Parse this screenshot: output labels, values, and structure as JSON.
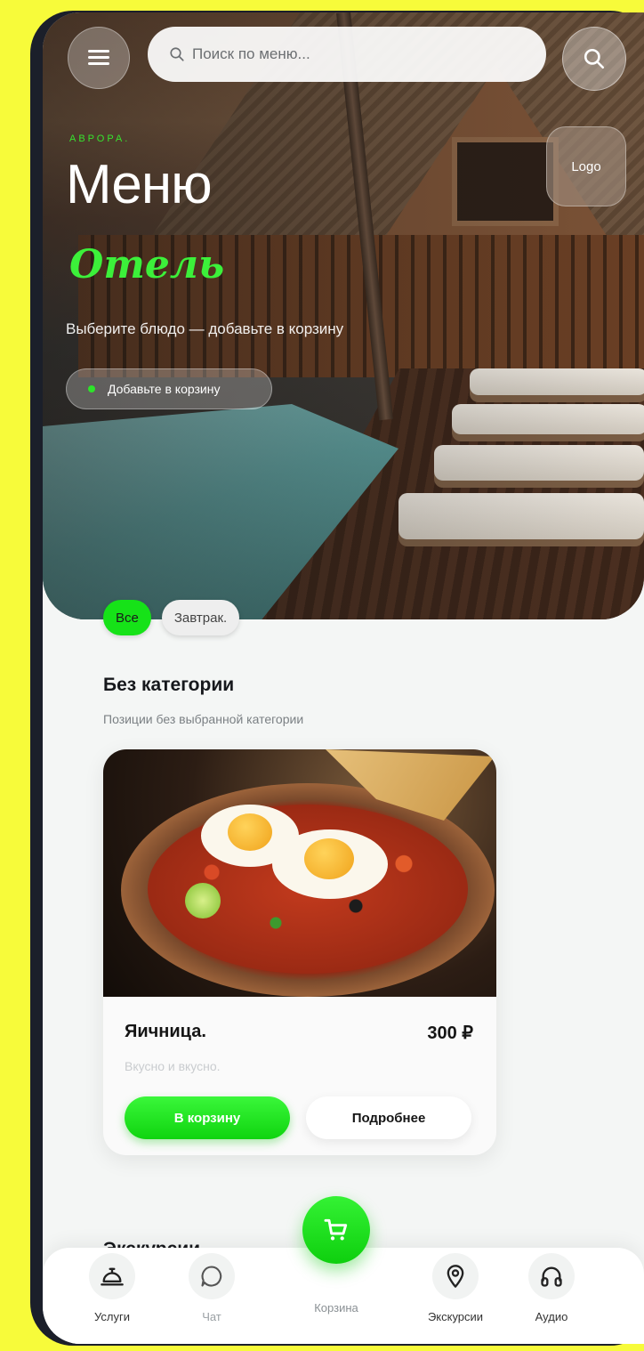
{
  "header": {
    "search_placeholder": "Поиск по меню...",
    "logo_text": "Logo"
  },
  "hero": {
    "brand": "АВРОРА.",
    "title": "Меню",
    "subtitle": "Отель",
    "tagline": "Выберите блюдо — добавьте в корзину",
    "badge": "Добавьте в корзину"
  },
  "categories": {
    "chips": [
      {
        "label": "Все",
        "active": true
      },
      {
        "label": "Завтрак.",
        "active": false
      }
    ]
  },
  "sections": [
    {
      "title": "Без категории",
      "subtitle": "Позиции без выбранной категории",
      "items": [
        {
          "name": "Яичница.",
          "price": "300 ₽",
          "description": "Вкусно и вкусно.",
          "add_label": "В корзину",
          "details_label": "Подробнее"
        }
      ]
    },
    {
      "title": "Экскурсии"
    }
  ],
  "bottom_nav": {
    "items": [
      {
        "label": "Услуги",
        "icon": "bell-service-icon"
      },
      {
        "label": "Чат",
        "icon": "chat-icon"
      },
      {
        "label": "Корзина",
        "icon": "cart-icon"
      },
      {
        "label": "Экскурсии",
        "icon": "location-pin-icon"
      },
      {
        "label": "Аудио",
        "icon": "headphones-icon"
      }
    ]
  },
  "colors": {
    "accent": "#16e218",
    "background": "#f7fb3a"
  }
}
